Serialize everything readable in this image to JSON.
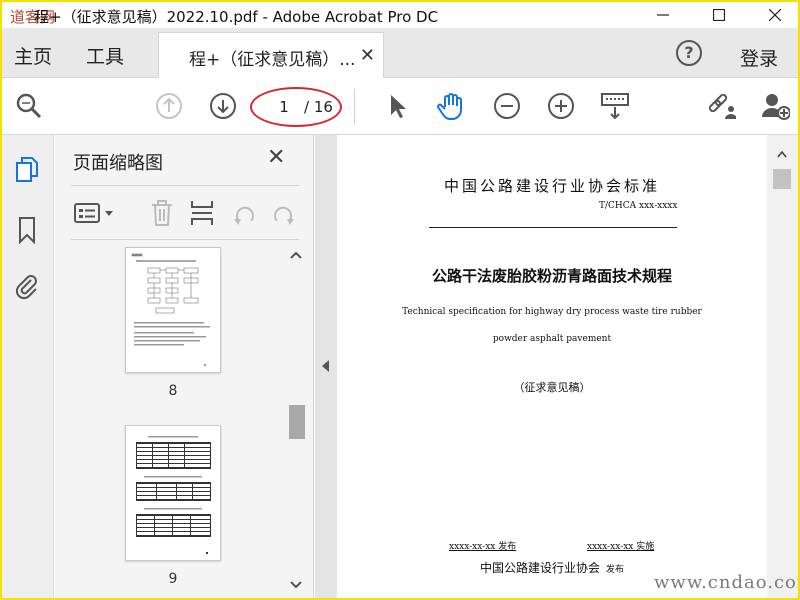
{
  "window": {
    "title": "程+（征求意见稿）2022.10.pdf - Adobe Acrobat Pro DC",
    "logo_text": "道客网"
  },
  "menubar": {
    "home": "主页",
    "tools": "工具",
    "doc_tab": "程+（征求意见稿）...",
    "login": "登录"
  },
  "toolbar": {
    "current_page": "1",
    "total_pages": "/ 16",
    "accent_color": "#1473e6"
  },
  "panel": {
    "title": "页面缩略图",
    "thumbnails": [
      {
        "label": "8"
      },
      {
        "label": "9"
      }
    ]
  },
  "document": {
    "org": "中国公路建设行业协会标准",
    "code": "T/CHCA  xxx-xxxx",
    "title_cn": "公路干法废胎胶粉沥青路面技术规程",
    "title_en_line1": "Technical specification for highway dry process waste tire rubber",
    "title_en_line2": "powder asphalt pavement",
    "draft": "（征求意见稿）",
    "publish": "xxxx-xx-xx 发布",
    "implement": "xxxx-xx-xx 实施",
    "issuer": "中国公路建设行业协会",
    "issuer_suffix": "发布"
  },
  "watermark": "www.cndao.com"
}
